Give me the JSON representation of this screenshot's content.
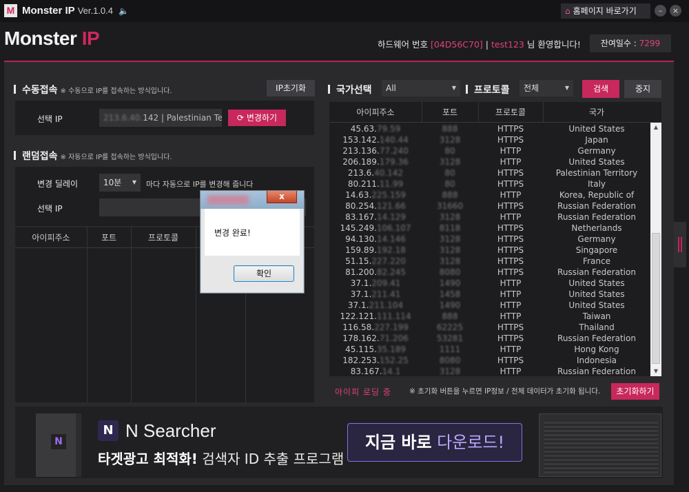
{
  "titlebar": {
    "logo": "M",
    "title": "Monster IP",
    "version": "Ver.1.0.4",
    "home_label": "홈페이지 바로가기",
    "minimize": "–",
    "close": "×"
  },
  "header": {
    "brand_main": "Monster ",
    "brand_ip": "IP",
    "hw_label": "하드웨어 번호",
    "hw_number": "[04D56C70]",
    "separator": "|",
    "user": "test123",
    "welcome_suffix": "님 환영합니다!",
    "remain_label": "잔여일수 :",
    "remain_days": "7299"
  },
  "manual": {
    "title": "수동접속",
    "note": "※ 수동으로 IP를 접속하는 방식입니다.",
    "reset_button": "IP초기화",
    "ip_label": "선택 IP",
    "ip_blur": "213.6.40.",
    "ip_value": "142 | Palestinian Ter",
    "change_button": "변경하기"
  },
  "random": {
    "title": "랜덤접속",
    "note": "※ 자동으로 IP를 접속하는 방식입니다.",
    "delay_label": "변경 딜레이",
    "delay_value": "10분",
    "delay_suffix": "마다 자동으로 IP를 변경해 줍니다",
    "ip_label": "선택 IP",
    "columns": [
      "아이피주소",
      "포트",
      "프로토콜"
    ]
  },
  "filters": {
    "country_title": "국가선택",
    "country_value": "All",
    "protocol_title": "프로토콜",
    "protocol_value": "전체",
    "search_button": "검색",
    "stop_button": "중지"
  },
  "proxy_table": {
    "columns": [
      "아이피주소",
      "포트",
      "프로토콜",
      "국가"
    ],
    "rows": [
      {
        "ip": "45.63.",
        "ip_blur": "79.59",
        "port": "888",
        "protocol": "HTTPS",
        "country": "United States"
      },
      {
        "ip": "153.142.",
        "ip_blur": "140.44",
        "port": "3128",
        "protocol": "HTTPS",
        "country": "Japan"
      },
      {
        "ip": "213.136.",
        "ip_blur": "77.240",
        "port": "80",
        "protocol": "HTTP",
        "country": "Germany"
      },
      {
        "ip": "206.189.",
        "ip_blur": "179.36",
        "port": "3128",
        "protocol": "HTTP",
        "country": "United States"
      },
      {
        "ip": "213.6.",
        "ip_blur": "40.142",
        "port": "80",
        "protocol": "HTTPS",
        "country": "Palestinian Territory"
      },
      {
        "ip": "80.211.",
        "ip_blur": "11.99",
        "port": "80",
        "protocol": "HTTPS",
        "country": "Italy"
      },
      {
        "ip": "14.63.",
        "ip_blur": "225.159",
        "port": "888",
        "protocol": "HTTP",
        "country": "Korea, Republic of"
      },
      {
        "ip": "80.254.",
        "ip_blur": "121.66",
        "port": "31660",
        "protocol": "HTTPS",
        "country": "Russian Federation"
      },
      {
        "ip": "83.167.",
        "ip_blur": "14.129",
        "port": "3128",
        "protocol": "HTTP",
        "country": "Russian Federation"
      },
      {
        "ip": "145.249.",
        "ip_blur": "106.107",
        "port": "8118",
        "protocol": "HTTPS",
        "country": "Netherlands"
      },
      {
        "ip": "94.130.",
        "ip_blur": "14.146",
        "port": "3128",
        "protocol": "HTTPS",
        "country": "Germany"
      },
      {
        "ip": "159.89.",
        "ip_blur": "192.18",
        "port": "3128",
        "protocol": "HTTPS",
        "country": "Singapore"
      },
      {
        "ip": "51.15.",
        "ip_blur": "227.220",
        "port": "3128",
        "protocol": "HTTPS",
        "country": "France"
      },
      {
        "ip": "81.200.",
        "ip_blur": "82.245",
        "port": "8080",
        "protocol": "HTTPS",
        "country": "Russian Federation"
      },
      {
        "ip": "37.1.",
        "ip_blur": "209.41",
        "port": "1490",
        "protocol": "HTTP",
        "country": "United States"
      },
      {
        "ip": "37.1.",
        "ip_blur": "211.41",
        "port": "1458",
        "protocol": "HTTP",
        "country": "United States"
      },
      {
        "ip": "37.1.",
        "ip_blur": "211.104",
        "port": "1490",
        "protocol": "HTTP",
        "country": "United States"
      },
      {
        "ip": "122.121.",
        "ip_blur": "111.114",
        "port": "888",
        "protocol": "HTTP",
        "country": "Taiwan"
      },
      {
        "ip": "116.58.",
        "ip_blur": "227.199",
        "port": "62225",
        "protocol": "HTTPS",
        "country": "Thailand"
      },
      {
        "ip": "178.162.",
        "ip_blur": "71.206",
        "port": "53281",
        "protocol": "HTTPS",
        "country": "Russian Federation"
      },
      {
        "ip": "45.115.",
        "ip_blur": "35.189",
        "port": "1111",
        "protocol": "HTTP",
        "country": "Hong Kong"
      },
      {
        "ip": "182.253.",
        "ip_blur": "152.25",
        "port": "8080",
        "protocol": "HTTPS",
        "country": "Indonesia"
      },
      {
        "ip": "83.167.",
        "ip_blur": "14.1",
        "port": "3128",
        "protocol": "HTTP",
        "country": "Russian Federation"
      }
    ]
  },
  "status": {
    "loading": "아이피 로딩 중",
    "notice": "※ 초기화 버튼을 누르면 IP정보 / 전체 데이터가 초기화 됩니다.",
    "reset_button": "초기화하기"
  },
  "banner": {
    "product_letter": "N",
    "product_name": "N Searcher",
    "tagline_bold": "타겟광고 최적화!",
    "tagline_rest": " 검색자 ID 추출 프로그램",
    "cta_bold": "지금 바로",
    "cta_rest": " 다운로드!"
  },
  "dialog": {
    "close": "x",
    "message": "변경 완료!",
    "ok_button": "확인"
  },
  "colors": {
    "accent": "#c8285c",
    "background": "#1c1c1e",
    "panel": "#2a2a2c"
  }
}
